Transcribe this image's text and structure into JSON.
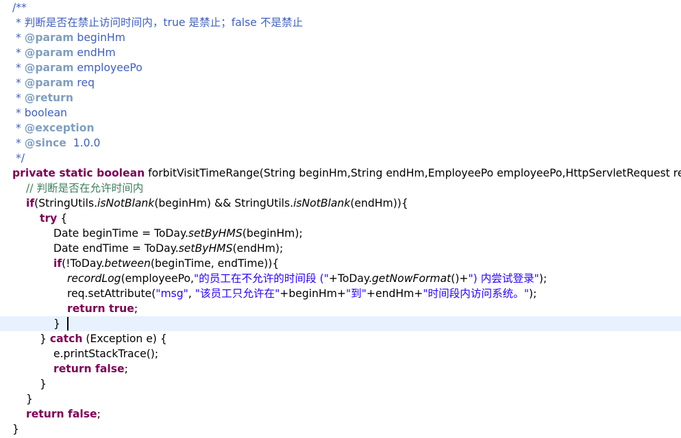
{
  "editor": {
    "cursor_line": 21,
    "lines": [
      {
        "indent": 0,
        "tokens": [
          {
            "t": "/**",
            "c": "javadoc"
          }
        ]
      },
      {
        "indent": 0,
        "tokens": [
          {
            "t": " * 判断是否在禁止访问时间内，true 是禁止；false 不是禁止",
            "c": "javadoc"
          }
        ]
      },
      {
        "indent": 0,
        "tokens": [
          {
            "t": " * ",
            "c": "javadoc"
          },
          {
            "t": "@param",
            "c": "doctag"
          },
          {
            "t": " beginHm",
            "c": "javadoc"
          }
        ]
      },
      {
        "indent": 0,
        "tokens": [
          {
            "t": " * ",
            "c": "javadoc"
          },
          {
            "t": "@param",
            "c": "doctag"
          },
          {
            "t": " endHm",
            "c": "javadoc"
          }
        ]
      },
      {
        "indent": 0,
        "tokens": [
          {
            "t": " * ",
            "c": "javadoc"
          },
          {
            "t": "@param",
            "c": "doctag"
          },
          {
            "t": " employeePo",
            "c": "javadoc"
          }
        ]
      },
      {
        "indent": 0,
        "tokens": [
          {
            "t": " * ",
            "c": "javadoc"
          },
          {
            "t": "@param",
            "c": "doctag"
          },
          {
            "t": " req",
            "c": "javadoc"
          }
        ]
      },
      {
        "indent": 0,
        "tokens": [
          {
            "t": " * ",
            "c": "javadoc"
          },
          {
            "t": "@return",
            "c": "doctag"
          }
        ]
      },
      {
        "indent": 0,
        "tokens": [
          {
            "t": " * boolean",
            "c": "javadoc"
          }
        ]
      },
      {
        "indent": 0,
        "tokens": [
          {
            "t": " * ",
            "c": "javadoc"
          },
          {
            "t": "@exception",
            "c": "doctag"
          }
        ]
      },
      {
        "indent": 0,
        "tokens": [
          {
            "t": " * ",
            "c": "javadoc"
          },
          {
            "t": "@since",
            "c": "doctag"
          },
          {
            "t": "  1.0.0",
            "c": "javadoc"
          }
        ]
      },
      {
        "indent": 0,
        "tokens": [
          {
            "t": " */",
            "c": "javadoc"
          }
        ]
      },
      {
        "indent": 0,
        "tokens": [
          {
            "t": "private static boolean",
            "c": "kw"
          },
          {
            "t": " forbitVisitTimeRange(String beginHm,String endHm,EmployeePo employeePo,HttpServletRequest req) {",
            "c": "plain"
          }
        ]
      },
      {
        "indent": 1,
        "tokens": [
          {
            "t": "// 判断是否在允许时间内",
            "c": "comment"
          }
        ]
      },
      {
        "indent": 1,
        "tokens": [
          {
            "t": "if",
            "c": "kw"
          },
          {
            "t": "(StringUtils.",
            "c": "plain"
          },
          {
            "t": "isNotBlank",
            "c": "plain ital"
          },
          {
            "t": "(beginHm) && StringUtils.",
            "c": "plain"
          },
          {
            "t": "isNotBlank",
            "c": "plain ital"
          },
          {
            "t": "(endHm)){",
            "c": "plain"
          }
        ]
      },
      {
        "indent": 2,
        "tokens": [
          {
            "t": "try",
            "c": "kw"
          },
          {
            "t": " {",
            "c": "plain"
          }
        ]
      },
      {
        "indent": 3,
        "tokens": [
          {
            "t": "Date beginTime = ToDay.",
            "c": "plain"
          },
          {
            "t": "setByHMS",
            "c": "plain ital"
          },
          {
            "t": "(beginHm);",
            "c": "plain"
          }
        ]
      },
      {
        "indent": 3,
        "tokens": [
          {
            "t": "Date endTime = ToDay.",
            "c": "plain"
          },
          {
            "t": "setByHMS",
            "c": "plain ital"
          },
          {
            "t": "(endHm);",
            "c": "plain"
          }
        ]
      },
      {
        "indent": 3,
        "tokens": [
          {
            "t": "if",
            "c": "kw"
          },
          {
            "t": "(!ToDay.",
            "c": "plain"
          },
          {
            "t": "between",
            "c": "plain ital"
          },
          {
            "t": "(beginTime, endTime)){",
            "c": "plain"
          }
        ]
      },
      {
        "indent": 4,
        "tokens": [
          {
            "t": "recordLog",
            "c": "plain ital"
          },
          {
            "t": "(employeePo,",
            "c": "plain"
          },
          {
            "t": "\"的员工在不允许的时间段 (\"",
            "c": "str"
          },
          {
            "t": "+ToDay.",
            "c": "plain"
          },
          {
            "t": "getNowFormat",
            "c": "plain ital"
          },
          {
            "t": "()+",
            "c": "plain"
          },
          {
            "t": "\") 内尝试登录\"",
            "c": "str"
          },
          {
            "t": ");",
            "c": "plain"
          }
        ]
      },
      {
        "indent": 4,
        "tokens": [
          {
            "t": "req.setAttribute(",
            "c": "plain"
          },
          {
            "t": "\"msg\"",
            "c": "str"
          },
          {
            "t": ", ",
            "c": "plain"
          },
          {
            "t": "\"该员工只允许在\"",
            "c": "str"
          },
          {
            "t": "+beginHm+",
            "c": "plain"
          },
          {
            "t": "\"到\"",
            "c": "str"
          },
          {
            "t": "+endHm+",
            "c": "plain"
          },
          {
            "t": "\"时间段内访问系统。\"",
            "c": "str"
          },
          {
            "t": ");",
            "c": "plain"
          }
        ]
      },
      {
        "indent": 4,
        "tokens": [
          {
            "t": "return true",
            "c": "kw"
          },
          {
            "t": ";",
            "c": "plain"
          }
        ]
      },
      {
        "indent": 3,
        "tokens": [
          {
            "t": "}",
            "c": "plain"
          }
        ]
      },
      {
        "indent": 2,
        "tokens": [
          {
            "t": "} ",
            "c": "plain"
          },
          {
            "t": "catch",
            "c": "kw"
          },
          {
            "t": " (Exception e) {",
            "c": "plain"
          }
        ]
      },
      {
        "indent": 3,
        "tokens": [
          {
            "t": "e.printStackTrace();",
            "c": "plain"
          }
        ]
      },
      {
        "indent": 3,
        "tokens": [
          {
            "t": "return false",
            "c": "kw"
          },
          {
            "t": ";",
            "c": "plain"
          }
        ]
      },
      {
        "indent": 2,
        "tokens": [
          {
            "t": "}",
            "c": "plain"
          }
        ]
      },
      {
        "indent": 1,
        "tokens": [
          {
            "t": "}",
            "c": "plain"
          }
        ]
      },
      {
        "indent": 1,
        "tokens": [
          {
            "t": "return false",
            "c": "kw"
          },
          {
            "t": ";",
            "c": "plain"
          }
        ]
      },
      {
        "indent": 0,
        "tokens": [
          {
            "t": "}",
            "c": "plain"
          }
        ]
      }
    ]
  },
  "colors": {
    "javadoc": "#3f5fbf",
    "javadoc_tag": "#7f9fbf",
    "comment": "#3f7f5f",
    "keyword": "#7f0055",
    "string": "#2a00ff",
    "current_line": "#e8f2fe"
  }
}
